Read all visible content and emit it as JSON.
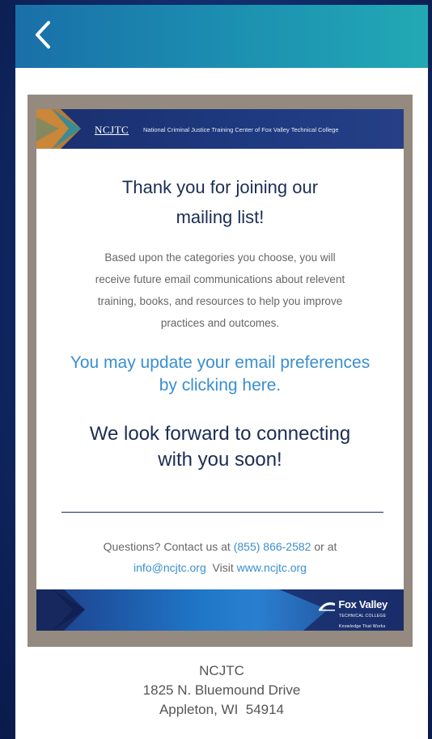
{
  "app_bar": {
    "back_icon": "chevron-left-icon",
    "gradient_start": "#1a6fa8",
    "gradient_end": "#22a9b5"
  },
  "email": {
    "header": {
      "brand": "NCJTC",
      "tagline": "National Criminal Justice Training Center of Fox Valley Technical College"
    },
    "heading_line1": "Thank you for joining our",
    "heading_line2": "mailing list!",
    "body_lines": [
      "Based upon the categories you choose, you will",
      "receive future email communications about relevent",
      "training, books, and resources to help you improve",
      "practices and outcomes."
    ],
    "preferences_line1": "You may update your email preferences",
    "preferences_line2": "by clicking here.",
    "closing_line1": "We look forward to connecting",
    "closing_line2": "with you soon!",
    "contact": {
      "prefix": "Questions? Contact us at",
      "phone": "(855) 866-2582",
      "or_at": "or at",
      "email": "info@ncjtc.org",
      "visit": "Visit",
      "website": "www.ncjtc.org"
    },
    "footer_logo": {
      "name": "Fox Valley",
      "sub": "TECHNICAL COLLEGE",
      "motto": "Knowledge That Works"
    }
  },
  "address": {
    "line1": "NCJTC",
    "line2": "1825 N. Bluemound Drive",
    "line3": "Appleton, WI  54914"
  },
  "colors": {
    "navy": "#1b2d55",
    "link_blue": "#3a8fd0",
    "frame_taupe": "#948a80"
  }
}
